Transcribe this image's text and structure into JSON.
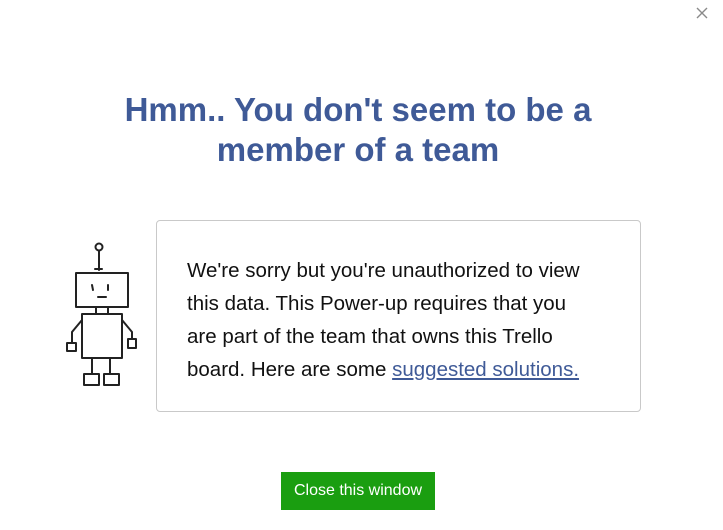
{
  "dialog": {
    "close_icon": "close-icon",
    "title_line_1": "Hmm.. You don't seem to be a",
    "title_line_2": "member of a team",
    "illustration": "robot-icon",
    "message": {
      "line_1": "We're sorry but you're unauthorized to view",
      "line_2": "this data. This Power-up requires that you",
      "line_3": "are part of the team that owns this Trello",
      "line_4_prefix": "board. Here are some ",
      "link_text": "suggested solutions."
    },
    "close_button_label": "Close this window"
  },
  "colors": {
    "title": "#3f5a97",
    "link": "#3f5a97",
    "button": "#1a9e10",
    "border": "#c9c9c9"
  }
}
